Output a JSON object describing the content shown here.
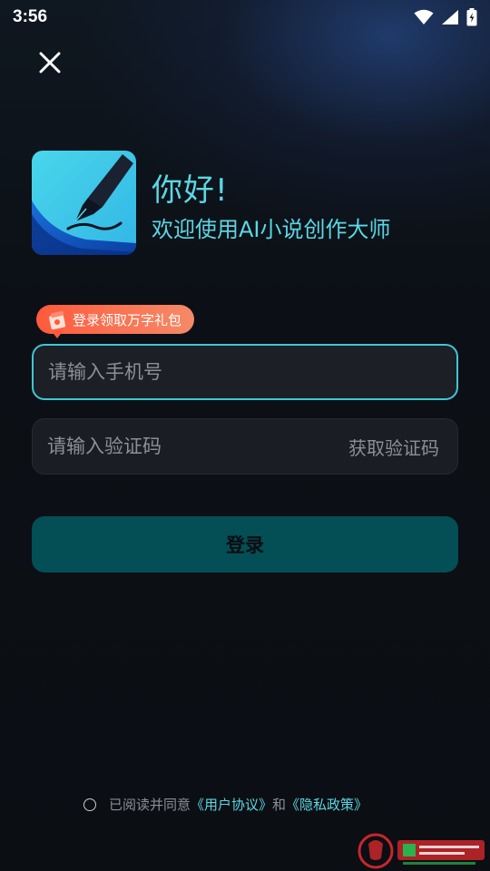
{
  "status_bar": {
    "time": "3:56",
    "icons": [
      "wifi-icon",
      "signal-icon",
      "battery-charging-icon"
    ]
  },
  "header": {
    "close_icon": "close-icon"
  },
  "brand": {
    "logo_icon": "pen-nib-logo",
    "greeting": "你好!",
    "subtitle": "欢迎使用AI小说创作大师"
  },
  "promo": {
    "icon": "gift-icon",
    "label": "登录领取万字礼包"
  },
  "form": {
    "phone_placeholder": "请输入手机号",
    "phone_value": "",
    "code_placeholder": "请输入验证码",
    "code_value": "",
    "get_code_label": "获取验证码",
    "login_label": "登录"
  },
  "agreement": {
    "prefix": "已阅读并同意",
    "user_agreement": "《用户协议》",
    "and": "和",
    "privacy_policy": "《隐私政策》"
  },
  "colors": {
    "accent": "#5cd7e4",
    "input_border_focus": "#3fc6d3",
    "login_button": "#044e55",
    "promo_gradient_start": "#ff5a3c",
    "promo_gradient_end": "#f48a68",
    "background": "#0c0f14"
  }
}
